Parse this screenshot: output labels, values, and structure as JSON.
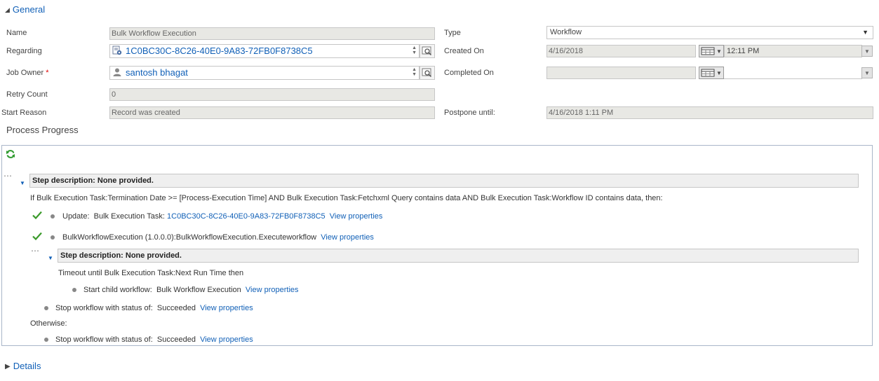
{
  "general": {
    "header": "General",
    "name_label": "Name",
    "name_value": "Bulk Workflow Execution",
    "regarding_label": "Regarding",
    "regarding_value": "1C0BC30C-8C26-40E0-9A83-72FB0F8738C5",
    "job_owner_label": "Job Owner",
    "required_marker": "*",
    "job_owner_value": "santosh bhagat",
    "retry_count_label": "Retry Count",
    "retry_count_value": "0",
    "start_reason_label": "Start Reason",
    "start_reason_value": "Record was created",
    "type_label": "Type",
    "type_value": "Workflow",
    "created_on_label": "Created On",
    "created_on_date": "4/16/2018",
    "created_on_time": "12:11 PM",
    "completed_on_label": "Completed On",
    "completed_on_date": "",
    "completed_on_time": "",
    "postpone_label": "Postpone until:",
    "postpone_value": "4/16/2018 1:11 PM"
  },
  "process_progress": {
    "title": "Process Progress",
    "step1_desc": "Step description: None provided.",
    "condition_text": "If Bulk Execution Task:Termination Date >= [Process-Execution Time] AND Bulk Execution Task:Fetchxml Query contains data AND Bulk Execution Task:Workflow ID contains data, then:",
    "update_label": "Update:",
    "update_entity": "Bulk Execution Task:",
    "update_link": "1C0BC30C-8C26-40E0-9A83-72FB0F8738C5",
    "view_properties": "View properties",
    "custom_step": "BulkWorkflowExecution (1.0.0.0):BulkWorkflowExecution.Executeworkflow",
    "step2_desc": "Step description: None provided.",
    "timeout_text": "Timeout until Bulk Execution Task:Next Run Time then",
    "child_workflow_label": "Start child workflow:",
    "child_workflow_value": "Bulk Workflow Execution",
    "stop_label": "Stop workflow with status of:",
    "stop_value": "Succeeded",
    "otherwise": "Otherwise:"
  },
  "details": {
    "header": "Details"
  },
  "colors": {
    "link": "#1160b7",
    "check": "#3a9a2a",
    "required": "#e00000"
  }
}
